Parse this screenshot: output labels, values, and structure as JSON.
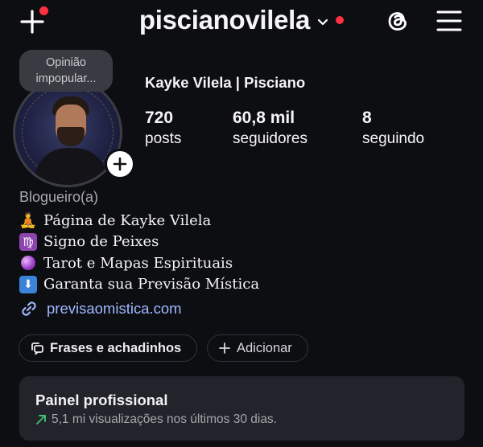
{
  "header": {
    "username": "piscianovilela",
    "colors": {
      "notification_dot": "#ff3040"
    }
  },
  "profile": {
    "note": [
      "Opinião",
      "impopular..."
    ],
    "display_name": "Kayke Vilela | Pisciano",
    "stats": [
      {
        "value": "720",
        "label": "posts"
      },
      {
        "value": "60,8 mil",
        "label": "seguidores"
      },
      {
        "value": "8",
        "label": "seguindo"
      }
    ]
  },
  "bio": {
    "category": "Blogueiro(a)",
    "lines": [
      {
        "icon": "person-sitting-icon",
        "text": "Página de Kayke Vilela"
      },
      {
        "icon": "virgo-sign-icon",
        "text": "Signo de Peixes"
      },
      {
        "icon": "crystal-ball-icon",
        "text": "Tarot e Mapas Espirituais"
      },
      {
        "icon": "down-arrow-icon",
        "text": "Garanta sua Previsão Mística"
      }
    ],
    "link": "previsaomistica.com"
  },
  "chips": {
    "highlight": "Frases e achadinhos",
    "add": "Adicionar"
  },
  "panel": {
    "title": "Painel profissional",
    "subtitle": "5,1 mi visualizações nos últimos 30 dias."
  }
}
